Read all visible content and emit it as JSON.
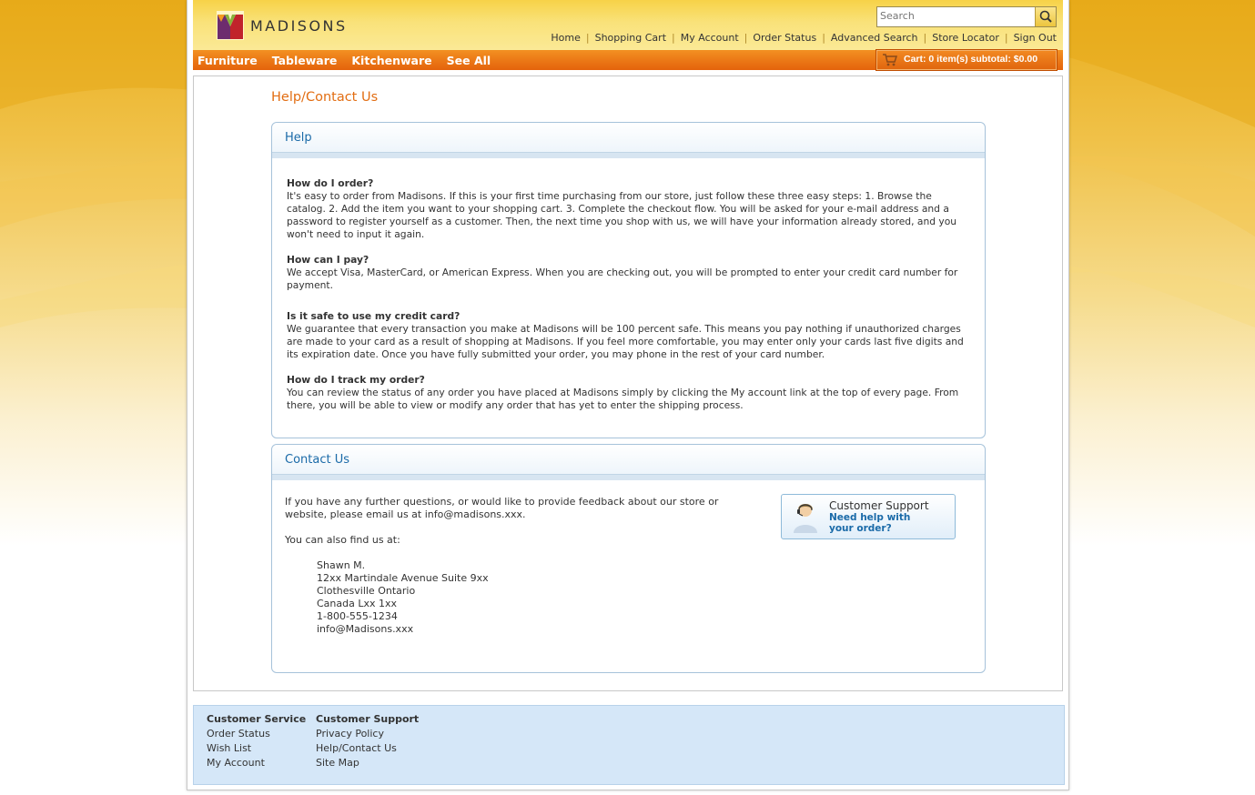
{
  "brand": {
    "name": "MADISONS"
  },
  "search": {
    "placeholder": "Search"
  },
  "top_links": [
    "Home",
    "Shopping Cart",
    "My Account",
    "Order Status",
    "Advanced Search",
    "Store Locator",
    "Sign Out"
  ],
  "nav": {
    "items": [
      "Furniture",
      "Tableware",
      "Kitchenware",
      "See All"
    ]
  },
  "cart": {
    "label": "Cart: 0 item(s) subtotal: $0.00"
  },
  "page_title": "Help/Contact Us",
  "help": {
    "title": "Help",
    "faqs": [
      {
        "q": "How do I order?",
        "a": "It's easy to order from Madisons. If this is your first time purchasing from our store, just follow these three easy steps: 1. Browse the catalog. 2. Add the item you want to your shopping cart. 3. Complete the checkout flow. You will be asked for your e-mail address and a password to register yourself as a customer. Then, the next time you shop with us, we will have your information already stored, and you won't need to input it again."
      },
      {
        "q": "How can I pay?",
        "a": "We accept Visa, MasterCard, or American Express. When you are checking out, you will be prompted to enter your credit card number for payment."
      },
      {
        "q": "Is it safe to use my credit card?",
        "a": "We guarantee that every transaction you make at Madisons will be 100 percent safe. This means you pay nothing if unauthorized charges are made to your card as a result of shopping at Madisons. If you feel more comfortable, you may enter only your cards last five digits and its expiration date. Once you have fully submitted your order, you may phone in the rest of your card number."
      },
      {
        "q": "How do I track my order?",
        "a": "You can review the status of any order you have placed at Madisons simply by clicking the My account link at the top of every page. From there, you will be able to view or modify any order that has yet to enter the shipping process."
      }
    ]
  },
  "contact": {
    "title": "Contact Us",
    "intro": "If you have any further questions, or would like to provide feedback about our store or website, please email us at info@madisons.xxx.",
    "find_us": "You can also find us at:",
    "address": [
      "Shawn M.",
      "12xx Martindale Avenue Suite 9xx",
      "Clothesville Ontario",
      "Canada Lxx 1xx",
      "1-800-555-1234",
      "info@Madisons.xxx"
    ]
  },
  "support": {
    "title": "Customer Support",
    "subtitle": "Need help with your order?"
  },
  "footer": {
    "col1": {
      "heading": "Customer Service",
      "links": [
        "Order Status",
        "Wish List",
        "My Account"
      ]
    },
    "col2": {
      "heading": "Customer Support",
      "links": [
        "Privacy Policy",
        "Help/Contact Us",
        "Site Map"
      ]
    }
  },
  "colors": {
    "accent_orange": "#e26d12",
    "link_blue": "#1a6aa8",
    "footer_bg": "#d5e7f8"
  }
}
